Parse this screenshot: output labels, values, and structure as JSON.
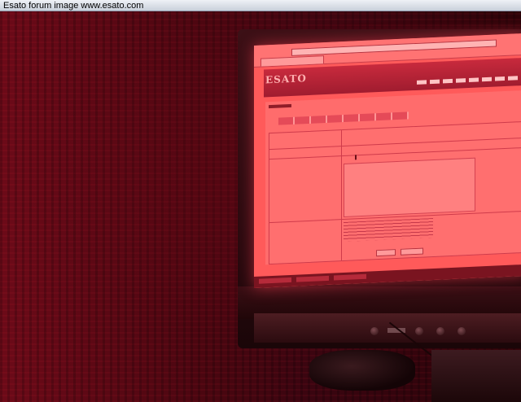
{
  "window": {
    "title": "Esato forum image www.esato.com"
  },
  "colors": {
    "titlebar_bg": "#d6dce6",
    "scene_tint": "#4a0610",
    "screen_glow": "#ff5a5a"
  }
}
